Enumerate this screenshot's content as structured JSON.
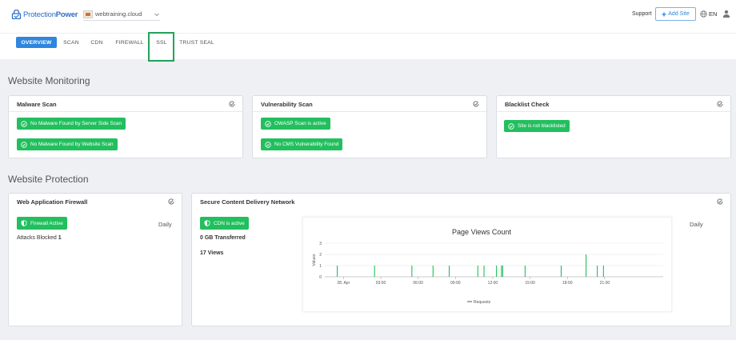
{
  "brand": {
    "prefix": "Protection",
    "suffix": "Power"
  },
  "site_selector": {
    "value": "webtraining.cloud"
  },
  "header": {
    "support_label": "Support",
    "add_site_label": "Add Site",
    "language": "EN"
  },
  "tabs": [
    {
      "label": "OVERVIEW",
      "active": true
    },
    {
      "label": "SCAN"
    },
    {
      "label": "CDN"
    },
    {
      "label": "FIREWALL"
    },
    {
      "label": "SSL"
    },
    {
      "label": "TRUST SEAL"
    }
  ],
  "monitoring": {
    "title": "Website Monitoring",
    "malware": {
      "title": "Malware Scan",
      "items": [
        "No Malware Found by Server Side Scan",
        "No Malware Found by Website Scan"
      ]
    },
    "vulnerability": {
      "title": "Vulnerability Scan",
      "items": [
        "OWASP Scan is active",
        "No CMS Vulnerability Found"
      ]
    },
    "blacklist": {
      "title": "Blacklist Check",
      "items": [
        "Site is not blacklisted"
      ]
    }
  },
  "protection": {
    "title": "Website Protection",
    "waf": {
      "title": "Web Application Firewall",
      "status": "Firewall Active",
      "frequency": "Daily",
      "attacks_label": "Attacks Blocked",
      "attacks_value": "1"
    },
    "cdn": {
      "title": "Secure Content Delivery Network",
      "status": "CDN is active",
      "transferred": "0 GB Transferred",
      "views": "17 Views",
      "frequency": "Daily"
    }
  },
  "colors": {
    "accent": "#2e86de",
    "success": "#22bf5e",
    "highlight": "#22a35a",
    "series": "#22bf5e"
  },
  "chart_data": {
    "type": "bar",
    "title": "Page Views Count",
    "ylabel": "Values",
    "legend": "Requests",
    "ylim": [
      0,
      3
    ],
    "yticks": [
      0,
      1,
      2,
      3
    ],
    "x_range_hours": [
      0,
      24
    ],
    "x_ticks": [
      {
        "label": "28. Apr",
        "hour": 0
      },
      {
        "label": "03:00",
        "hour": 3
      },
      {
        "label": "06:00",
        "hour": 6
      },
      {
        "label": "09:00",
        "hour": 9
      },
      {
        "label": "12:00",
        "hour": 12
      },
      {
        "label": "15:00",
        "hour": 15
      },
      {
        "label": "18:00",
        "hour": 18
      },
      {
        "label": "21:00",
        "hour": 21
      }
    ],
    "series": [
      {
        "name": "Requests",
        "points": [
          {
            "hour": -0.5,
            "value": 1
          },
          {
            "hour": 2.5,
            "value": 1
          },
          {
            "hour": 5.5,
            "value": 1
          },
          {
            "hour": 7.2,
            "value": 1
          },
          {
            "hour": 8.5,
            "value": 1
          },
          {
            "hour": 10.8,
            "value": 1
          },
          {
            "hour": 11.3,
            "value": 1
          },
          {
            "hour": 12.3,
            "value": 1
          },
          {
            "hour": 12.7,
            "value": 1
          },
          {
            "hour": 12.8,
            "value": 1
          },
          {
            "hour": 14.6,
            "value": 1
          },
          {
            "hour": 17.5,
            "value": 1
          },
          {
            "hour": 19.5,
            "value": 2
          },
          {
            "hour": 20.4,
            "value": 1
          },
          {
            "hour": 20.9,
            "value": 1
          }
        ]
      }
    ]
  }
}
